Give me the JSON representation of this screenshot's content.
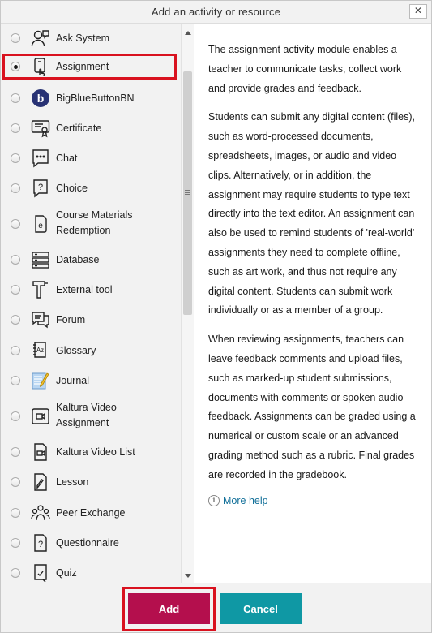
{
  "dialog": {
    "title": "Add an activity or resource",
    "close_label": "✕"
  },
  "options": [
    {
      "label": "Ask System",
      "icon": "ask-system-icon",
      "checked": false
    },
    {
      "label": "Assignment",
      "icon": "assignment-icon",
      "checked": true
    },
    {
      "label": "BigBlueButtonBN",
      "icon": "bigbluebutton-icon",
      "checked": false
    },
    {
      "label": "Certificate",
      "icon": "certificate-icon",
      "checked": false
    },
    {
      "label": "Chat",
      "icon": "chat-icon",
      "checked": false
    },
    {
      "label": "Choice",
      "icon": "choice-icon",
      "checked": false
    },
    {
      "label": "Course Materials Redemption",
      "label_line1": "Course Materials",
      "label_line2": "Redemption",
      "icon": "course-materials-icon",
      "checked": false
    },
    {
      "label": "Database",
      "icon": "database-icon",
      "checked": false
    },
    {
      "label": "External tool",
      "icon": "external-tool-icon",
      "checked": false
    },
    {
      "label": "Forum",
      "icon": "forum-icon",
      "checked": false
    },
    {
      "label": "Glossary",
      "icon": "glossary-icon",
      "checked": false
    },
    {
      "label": "Journal",
      "icon": "journal-icon",
      "checked": false
    },
    {
      "label": "Kaltura Video Assignment",
      "label_line1": "Kaltura Video",
      "label_line2": "Assignment",
      "icon": "kaltura-video-icon",
      "checked": false
    },
    {
      "label": "Kaltura Video List",
      "icon": "kaltura-list-icon",
      "checked": false
    },
    {
      "label": "Lesson",
      "icon": "lesson-icon",
      "checked": false
    },
    {
      "label": "Peer Exchange",
      "icon": "peer-exchange-icon",
      "checked": false
    },
    {
      "label": "Questionnaire",
      "icon": "questionnaire-icon",
      "checked": false
    },
    {
      "label": "Quiz",
      "icon": "quiz-icon",
      "checked": false
    }
  ],
  "description": {
    "paragraphs": [
      "The assignment activity module enables a teacher to communicate tasks, collect work and provide grades and feedback.",
      "Students can submit any digital content (files), such as word-processed documents, spreadsheets, images, or audio and video clips. Alternatively, or in addition, the assignment may require students to type text directly into the text editor. An assignment can also be used to remind students of 'real-world' assignments they need to complete offline, such as art work, and thus not require any digital content. Students can submit work individually or as a member of a group.",
      "When reviewing assignments, teachers can leave feedback comments and upload files, such as marked-up student submissions, documents with comments or spoken audio feedback. Assignments can be graded using a numerical or custom scale or an advanced grading method such as a rubric. Final grades are recorded in the gradebook."
    ],
    "help_link": "More help"
  },
  "footer": {
    "add_label": "Add",
    "cancel_label": "Cancel"
  },
  "colors": {
    "add_button": "#b40f4d",
    "cancel_button": "#0f98a4",
    "highlight": "#d9121f",
    "link": "#0f6e98"
  }
}
